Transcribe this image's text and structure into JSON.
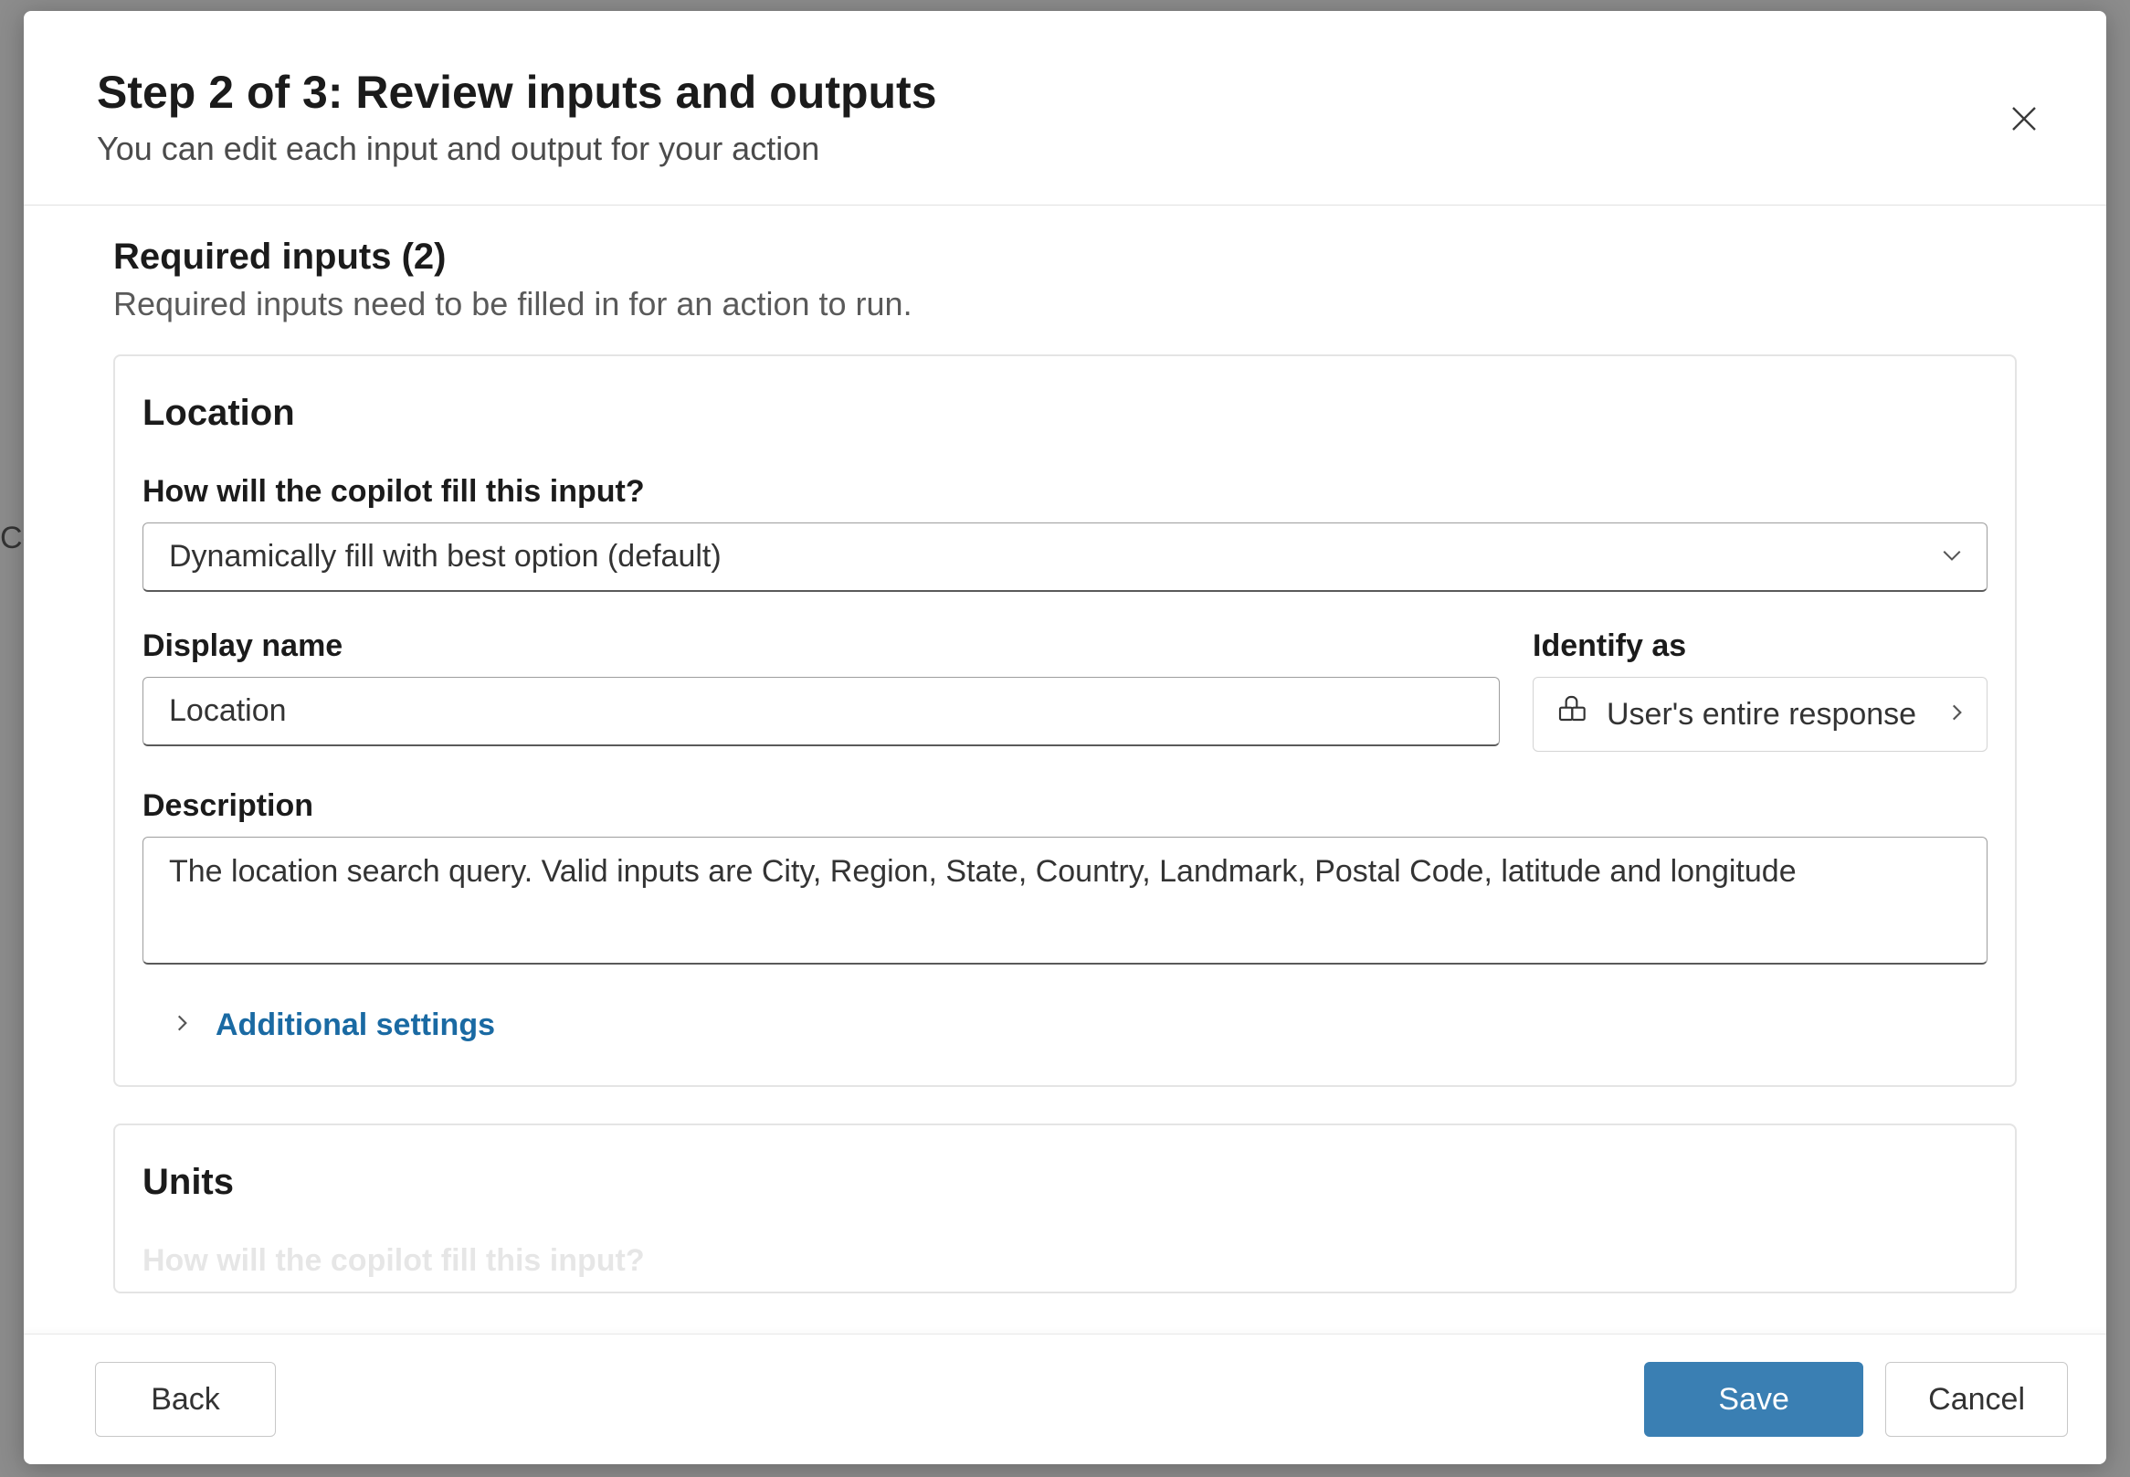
{
  "backdrop": {
    "left_text": "Co"
  },
  "header": {
    "title": "Step 2 of 3: Review inputs and outputs",
    "subtitle": "You can edit each input and output for your action"
  },
  "required_inputs": {
    "heading": "Required inputs (2)",
    "subtext": "Required inputs need to be filled in for an action to run."
  },
  "cards": [
    {
      "title": "Location",
      "fill_label": "How will the copilot fill this input?",
      "fill_value": "Dynamically fill with best option (default)",
      "display_name_label": "Display name",
      "display_name_value": "Location",
      "identify_label": "Identify as",
      "identify_value": "User's entire response",
      "description_label": "Description",
      "description_value": "The location search query. Valid inputs are City, Region, State, Country, Landmark, Postal Code, latitude and longitude",
      "additional": "Additional settings"
    },
    {
      "title": "Units",
      "fill_label": "How will the copilot fill this input?"
    }
  ],
  "footer": {
    "back": "Back",
    "save": "Save",
    "cancel": "Cancel"
  }
}
